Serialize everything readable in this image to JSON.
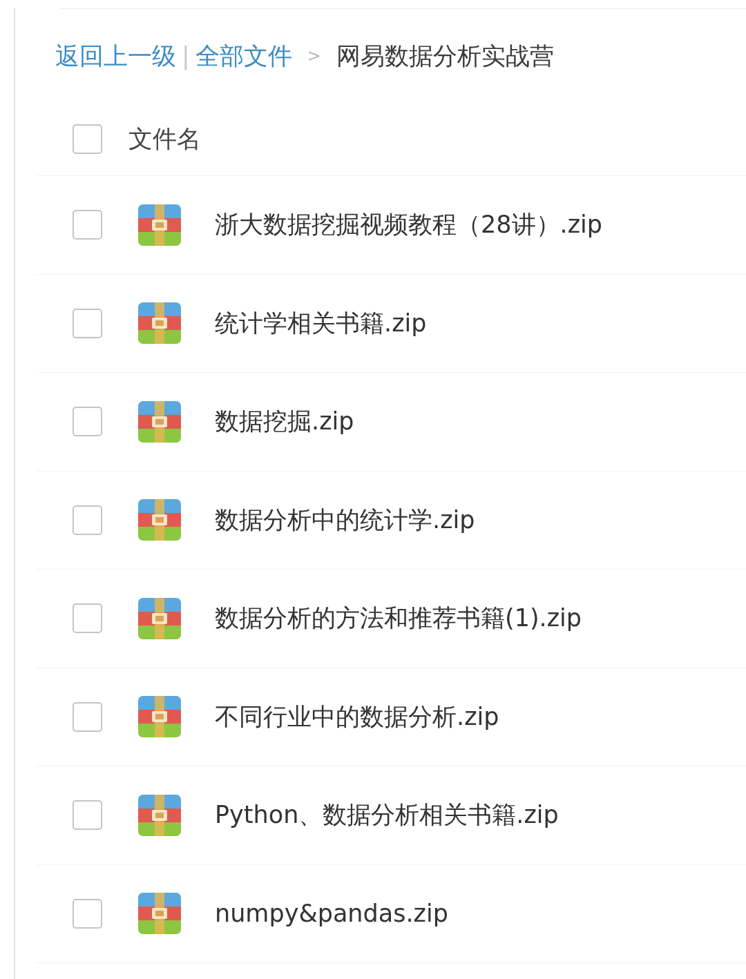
{
  "breadcrumb": {
    "back_link": "返回上一级",
    "separator": "|",
    "root_link": "全部文件",
    "arrow": ">",
    "current": "网易数据分析实战营"
  },
  "file_list": {
    "header": {
      "label": "文件名",
      "checked": false
    },
    "files": [
      {
        "name": "浙大数据挖掘视频教程（28讲）.zip",
        "checked": false
      },
      {
        "name": "统计学相关书籍.zip",
        "checked": false
      },
      {
        "name": "数据挖掘.zip",
        "checked": false
      },
      {
        "name": "数据分析中的统计学.zip",
        "checked": false
      },
      {
        "name": "数据分析的方法和推荐书籍(1).zip",
        "checked": false
      },
      {
        "name": "不同行业中的数据分析.zip",
        "checked": false
      },
      {
        "name": "Python、数据分析相关书籍.zip",
        "checked": false
      },
      {
        "name": "numpy&pandas.zip",
        "checked": false
      }
    ]
  }
}
